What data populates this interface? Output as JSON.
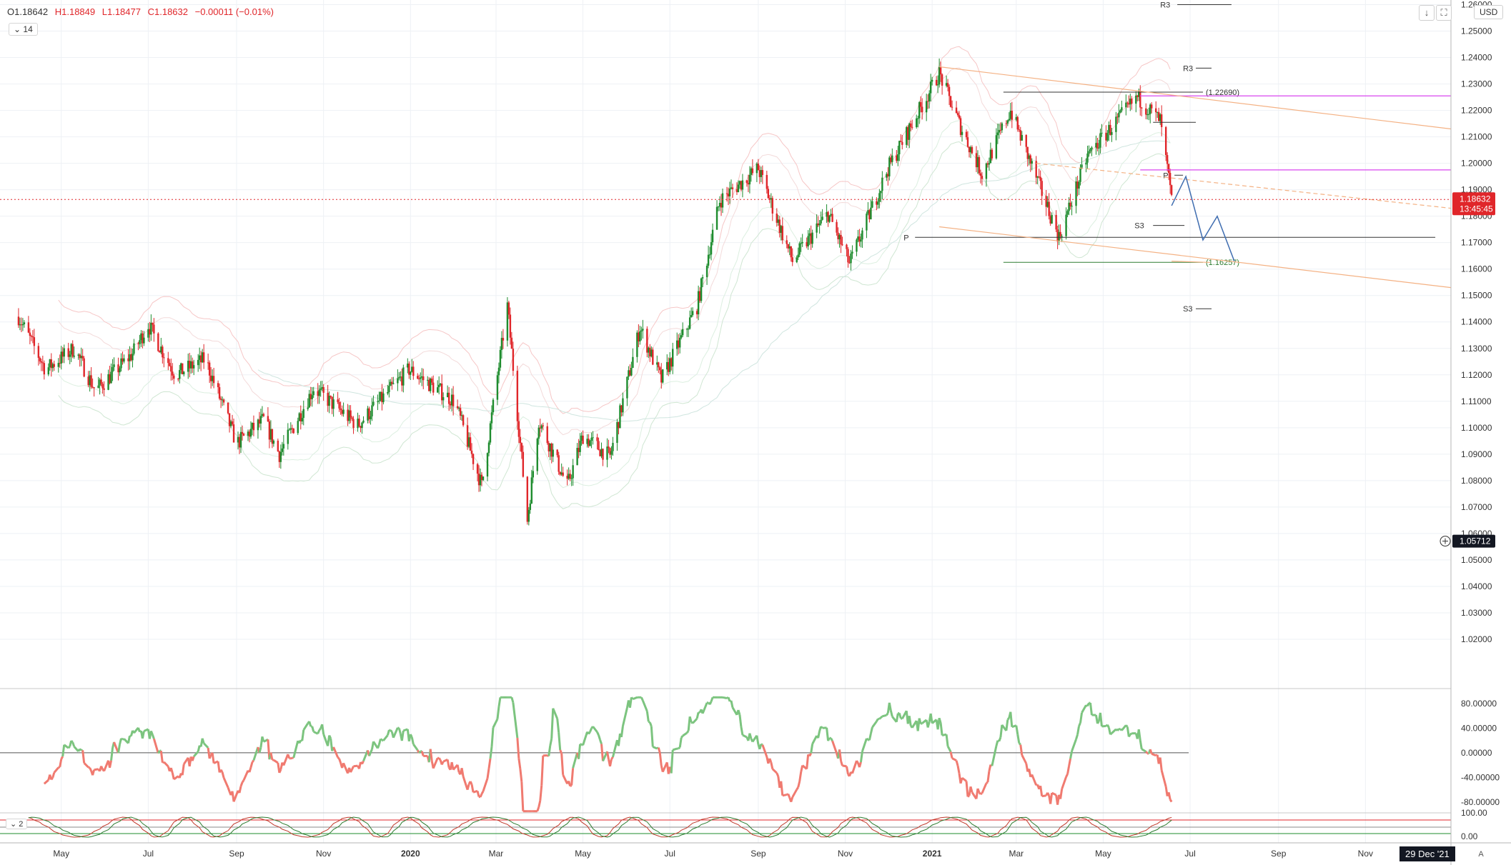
{
  "header": {
    "open": "O1.18642",
    "high": "H1.18849",
    "low": "L1.18477",
    "close": "C1.18632",
    "change": "−0.00011 (−0.01%)",
    "indicator_chip": "14",
    "osc_chip": "2",
    "currency": "USD",
    "auto_label": "A"
  },
  "badges": {
    "last_price": "1.18632",
    "countdown": "13:45:45",
    "cursor_price": "1.05712",
    "cursor_date": "29 Dec '21"
  },
  "colors": {
    "bull": "#1e8c2e",
    "bear": "#e0262a",
    "osc_up": "#7cc47f",
    "osc_down": "#f07a70",
    "magenta": "#d946ef",
    "orange": "#f4b183",
    "projection": "#3f6db0"
  },
  "chart_data": {
    "type": "candlestick",
    "price_axis": {
      "ylim": [
        1.01,
        1.265
      ],
      "ticks": [
        "1.26000",
        "1.25000",
        "1.24000",
        "1.23000",
        "1.22000",
        "1.21000",
        "1.20000",
        "1.19000",
        "1.18000",
        "1.17000",
        "1.16000",
        "1.15000",
        "1.14000",
        "1.13000",
        "1.12000",
        "1.11000",
        "1.10000",
        "1.09000",
        "1.08000",
        "1.07000",
        "1.06000",
        "1.05000",
        "1.04000",
        "1.03000",
        "1.02000"
      ]
    },
    "time_axis": {
      "labels": [
        "May",
        "Jul",
        "Sep",
        "Nov",
        "2020",
        "Mar",
        "May",
        "Jul",
        "Sep",
        "Nov",
        "2021",
        "Mar",
        "May",
        "Jul",
        "Sep",
        "Nov"
      ]
    },
    "price_path": [
      {
        "t": "2019-04-01",
        "p": 1.142
      },
      {
        "t": "2019-04-20",
        "p": 1.122
      },
      {
        "t": "2019-05-10",
        "p": 1.13
      },
      {
        "t": "2019-05-25",
        "p": 1.114
      },
      {
        "t": "2019-06-20",
        "p": 1.128
      },
      {
        "t": "2019-07-01",
        "p": 1.139
      },
      {
        "t": "2019-07-20",
        "p": 1.12
      },
      {
        "t": "2019-08-10",
        "p": 1.126
      },
      {
        "t": "2019-09-01",
        "p": 1.094
      },
      {
        "t": "2019-09-20",
        "p": 1.103
      },
      {
        "t": "2019-10-01",
        "p": 1.09
      },
      {
        "t": "2019-10-25",
        "p": 1.115
      },
      {
        "t": "2019-11-25",
        "p": 1.101
      },
      {
        "t": "2019-12-31",
        "p": 1.122
      },
      {
        "t": "2020-02-01",
        "p": 1.11
      },
      {
        "t": "2020-02-20",
        "p": 1.078
      },
      {
        "t": "2020-03-09",
        "p": 1.146
      },
      {
        "t": "2020-03-23",
        "p": 1.065
      },
      {
        "t": "2020-03-31",
        "p": 1.103
      },
      {
        "t": "2020-04-20",
        "p": 1.078
      },
      {
        "t": "2020-05-01",
        "p": 1.097
      },
      {
        "t": "2020-05-20",
        "p": 1.089
      },
      {
        "t": "2020-06-10",
        "p": 1.138
      },
      {
        "t": "2020-06-25",
        "p": 1.118
      },
      {
        "t": "2020-07-20",
        "p": 1.146
      },
      {
        "t": "2020-08-05",
        "p": 1.186
      },
      {
        "t": "2020-09-01",
        "p": 1.198
      },
      {
        "t": "2020-09-25",
        "p": 1.163
      },
      {
        "t": "2020-10-20",
        "p": 1.181
      },
      {
        "t": "2020-11-04",
        "p": 1.162
      },
      {
        "t": "2020-12-01",
        "p": 1.198
      },
      {
        "t": "2021-01-06",
        "p": 1.234
      },
      {
        "t": "2021-01-20",
        "p": 1.215
      },
      {
        "t": "2021-02-05",
        "p": 1.196
      },
      {
        "t": "2021-02-25",
        "p": 1.22
      },
      {
        "t": "2021-03-31",
        "p": 1.172
      },
      {
        "t": "2021-04-20",
        "p": 1.203
      },
      {
        "t": "2021-05-25",
        "p": 1.225
      },
      {
        "t": "2021-06-10",
        "p": 1.216
      },
      {
        "t": "2021-06-17",
        "p": 1.19
      },
      {
        "t": "2021-06-18",
        "p": 1.186
      }
    ],
    "projection_path": [
      {
        "t": "2021-06-18",
        "p": 1.184
      },
      {
        "t": "2021-06-28",
        "p": 1.195
      },
      {
        "t": "2021-07-10",
        "p": 1.171
      },
      {
        "t": "2021-07-20",
        "p": 1.18
      },
      {
        "t": "2021-08-01",
        "p": 1.163
      }
    ],
    "levels": [
      {
        "label": "R3",
        "price": 1.26
      },
      {
        "label": "R3",
        "price": 1.236
      },
      {
        "label": "",
        "price": 1.2269,
        "annotation": "(1.22690)"
      },
      {
        "label": "",
        "price": 1.2255,
        "color": "magenta"
      },
      {
        "label": "",
        "price": 1.2155
      },
      {
        "label": "",
        "price": 1.1975,
        "color": "magenta"
      },
      {
        "label": "P",
        "price": 1.1955
      },
      {
        "label": "S3",
        "price": 1.1765
      },
      {
        "label": "P",
        "price": 1.172
      },
      {
        "label": "",
        "price": 1.16257,
        "annotation": "(1.16257)"
      },
      {
        "label": "S3",
        "price": 1.145
      }
    ],
    "oscillator": {
      "ticks": [
        "80.00000",
        "40.00000",
        "0.00000",
        "-40.00000",
        "-80.00000"
      ],
      "ylim": [
        -100,
        95
      ]
    },
    "oscillator2": {
      "ticks": [
        "100.00",
        "0.00"
      ]
    }
  }
}
